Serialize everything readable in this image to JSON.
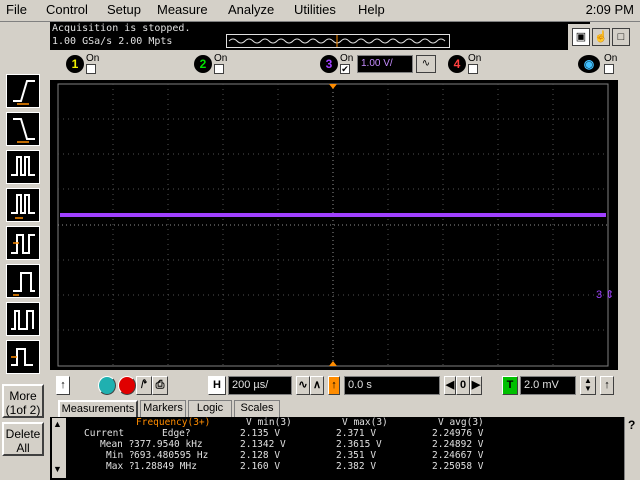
{
  "menu": {
    "items": [
      "File",
      "Control",
      "Setup",
      "Measure",
      "Analyze",
      "Utilities",
      "Help"
    ],
    "clock": "2:09 PM"
  },
  "status": {
    "line1": "Acquisition is stopped.",
    "line2": "1.00 GSa/s   2.00 Mpts"
  },
  "channels": [
    {
      "num": "1",
      "on_label": "On",
      "checked": false,
      "color": "#f0f000"
    },
    {
      "num": "2",
      "on_label": "On",
      "checked": false,
      "color": "#00e000"
    },
    {
      "num": "3",
      "on_label": "On",
      "checked": true,
      "color": "#a040ff",
      "scale": "1.00 V/"
    },
    {
      "num": "4",
      "on_label": "On",
      "checked": false,
      "color": "#ff4040"
    }
  ],
  "math_on_label": "On",
  "left_panel": {
    "more_label": "More (1of 2)",
    "delete_label": "Delete All"
  },
  "ground_marker": "3",
  "controls": {
    "h_label": "H",
    "timebase": "200 µs/",
    "delay": "0.0 s",
    "delay_nav_value": "0",
    "trigger_label": "T",
    "trigger_level": "2.0 mV"
  },
  "tabs": [
    "Measurements",
    "Markers",
    "Logic",
    "Scales"
  ],
  "measurements": {
    "headers": [
      "Frequency(3+)",
      "V min(3)",
      "V max(3)",
      "V avg(3)"
    ],
    "rows": [
      {
        "label": "Current",
        "freq": "Edge?",
        "vmin": "2.135 V",
        "vmax": "2.371 V",
        "vavg": "2.24976 V"
      },
      {
        "label": "Mean ?",
        "freq": "377.9540 kHz",
        "vmin": "2.1342 V",
        "vmax": "2.3615 V",
        "vavg": "2.24892 V"
      },
      {
        "label": "Min ?",
        "freq": "693.480595 Hz",
        "vmin": "2.128 V",
        "vmax": "2.351 V",
        "vavg": "2.24667 V"
      },
      {
        "label": "Max ?",
        "freq": "1.28849 MHz",
        "vmin": "2.160 V",
        "vmax": "2.382 V",
        "vavg": "2.25058 V"
      }
    ],
    "help_label": "?"
  },
  "colors": {
    "trace": "#a040ff",
    "trigger_marker": "#ff8c00",
    "background": "#d4d0c8"
  }
}
